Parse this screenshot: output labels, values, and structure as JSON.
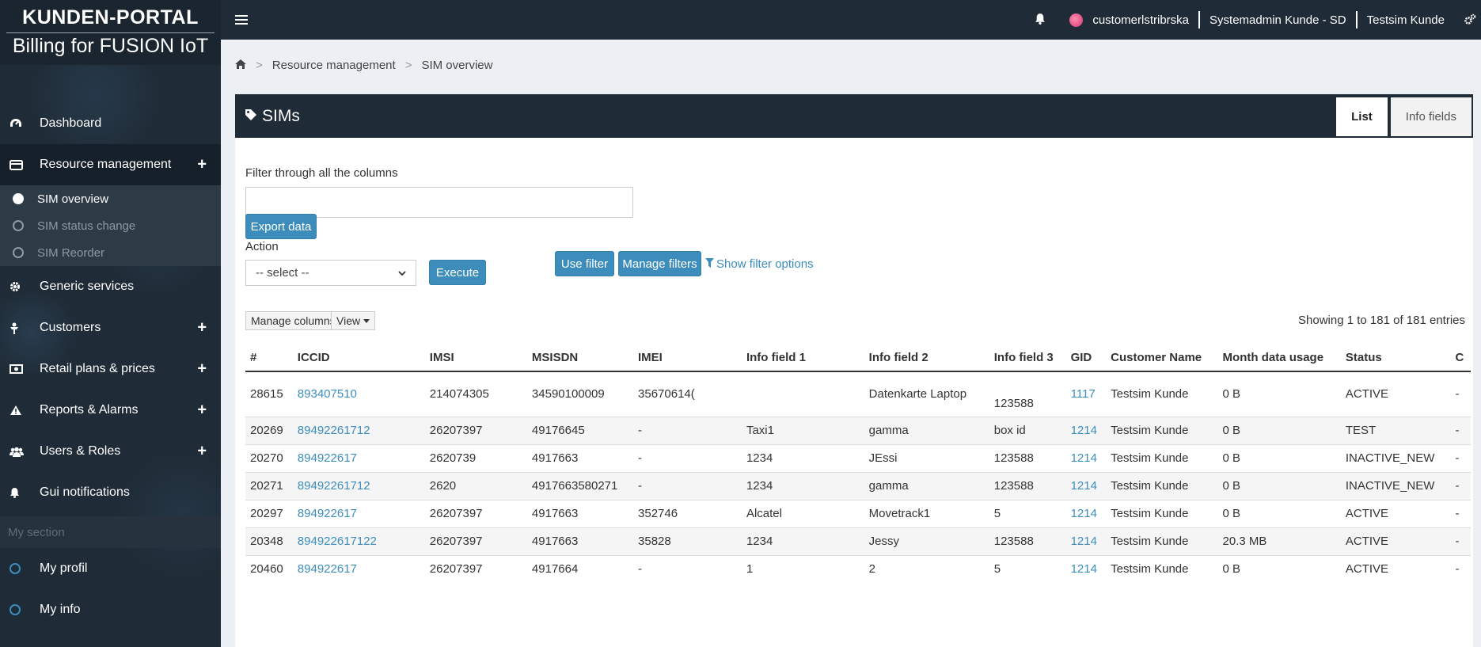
{
  "brand": {
    "title": "KUNDEN-PORTAL",
    "subtitle": "Billing for FUSION IoT"
  },
  "topbar": {
    "user": "customerlstribrska",
    "role": "Systemadmin Kunde - SD",
    "customer": "Testsim Kunde"
  },
  "sidebar": {
    "items": [
      {
        "label": "Dashboard",
        "icon": "dashboard-icon",
        "expandable": false
      },
      {
        "label": "Resource management",
        "icon": "card-icon",
        "expandable": true
      },
      {
        "label": "Generic services",
        "icon": "gear-icon",
        "expandable": false
      },
      {
        "label": "Customers",
        "icon": "user-icon",
        "expandable": true
      },
      {
        "label": "Retail plans & prices",
        "icon": "money-icon",
        "expandable": true
      },
      {
        "label": "Reports & Alarms",
        "icon": "warning-icon",
        "expandable": true
      },
      {
        "label": "Users & Roles",
        "icon": "users-icon",
        "expandable": true
      },
      {
        "label": "Gui notifications",
        "icon": "bell-icon",
        "expandable": false
      }
    ],
    "subitems": [
      {
        "label": "SIM overview"
      },
      {
        "label": "SIM status change"
      },
      {
        "label": "SIM Reorder"
      }
    ],
    "section_label": "My section",
    "section_items": [
      {
        "label": "My profil"
      },
      {
        "label": "My info"
      }
    ]
  },
  "breadcrumb": {
    "level1": "Resource management",
    "level2": "SIM overview"
  },
  "box": {
    "title": "SIMs",
    "tabs": [
      "List",
      "Info fields"
    ]
  },
  "filter": {
    "label": "Filter through all the columns",
    "value": "",
    "use_filter": "Use filter",
    "manage_filters": "Manage filters",
    "show_options": "Show filter options"
  },
  "export_label": "Export data",
  "action": {
    "label": "Action",
    "selected": "-- select --",
    "execute": "Execute"
  },
  "table_controls": {
    "manage_columns": "Manage columns",
    "view": "View",
    "showing": "Showing 1 to 181 of 181 entries"
  },
  "table": {
    "headers": [
      "#",
      "ICCID",
      "IMSI",
      "MSISDN",
      "IMEI",
      "Info field 1",
      "Info field 2",
      "Info field 3",
      "GID",
      "Customer Name",
      "Month data usage",
      "Status",
      "C"
    ],
    "rows": [
      [
        "28615",
        "893407510",
        "214074305",
        "34590100009",
        "35670614(",
        "",
        "Datenkarte Laptop",
        "123588",
        "1117",
        "Testsim Kunde",
        "0 B",
        "ACTIVE",
        "-"
      ],
      [
        "20269",
        "89492261712",
        "26207397",
        "49176645",
        "-",
        "Taxi1",
        "gamma",
        "box id",
        "1214",
        "Testsim Kunde",
        "0 B",
        "TEST",
        "-"
      ],
      [
        "20270",
        "894922617",
        "2620739",
        "4917663",
        "-",
        "1234",
        "JEssi",
        "123588",
        "1214",
        "Testsim Kunde",
        "0 B",
        "INACTIVE_NEW",
        "-"
      ],
      [
        "20271",
        "89492261712",
        "2620",
        "4917663580271",
        "-",
        "1234",
        "gamma",
        "123588",
        "1214",
        "Testsim Kunde",
        "0 B",
        "INACTIVE_NEW",
        "-"
      ],
      [
        "20297",
        "894922617",
        "26207397",
        "4917663",
        "352746",
        "Alcatel",
        "Movetrack1",
        "5",
        "1214",
        "Testsim Kunde",
        "0 B",
        "ACTIVE",
        "-"
      ],
      [
        "20348",
        "894922617122",
        "26207397",
        "4917663",
        "35828",
        "1234",
        "Jessy",
        "123588",
        "1214",
        "Testsim Kunde",
        "20.3 MB",
        "ACTIVE",
        "-"
      ],
      [
        "20460",
        "894922617",
        "26207397",
        "4917664",
        "-",
        "1",
        "2",
        "5",
        "1214",
        "Testsim Kunde",
        "0 B",
        "ACTIVE",
        "-"
      ]
    ]
  }
}
